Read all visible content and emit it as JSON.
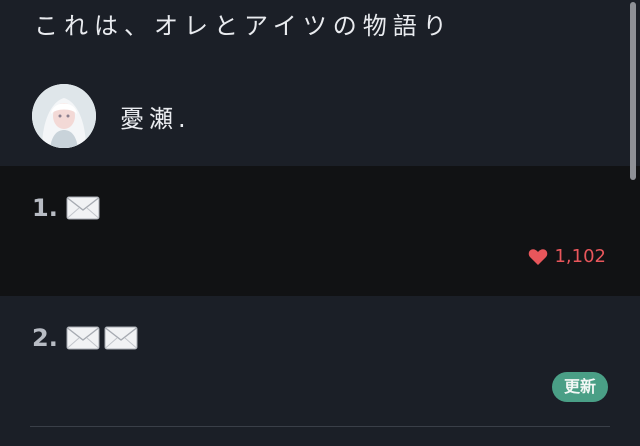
{
  "story": {
    "title": "これは、オレとアイツの物語り",
    "author": "憂瀬."
  },
  "episodes": [
    {
      "number": "1.",
      "envelopes": 1,
      "likes": "1,102"
    },
    {
      "number": "2.",
      "envelopes": 2,
      "badge": "更新"
    }
  ],
  "icons": {
    "envelope": "envelope-icon",
    "like": "heart-icon"
  },
  "colors": {
    "background": "#1b1f27",
    "episode_active_bg": "#111214",
    "like_red": "#e8565b",
    "badge_green": "#4a9f86"
  }
}
